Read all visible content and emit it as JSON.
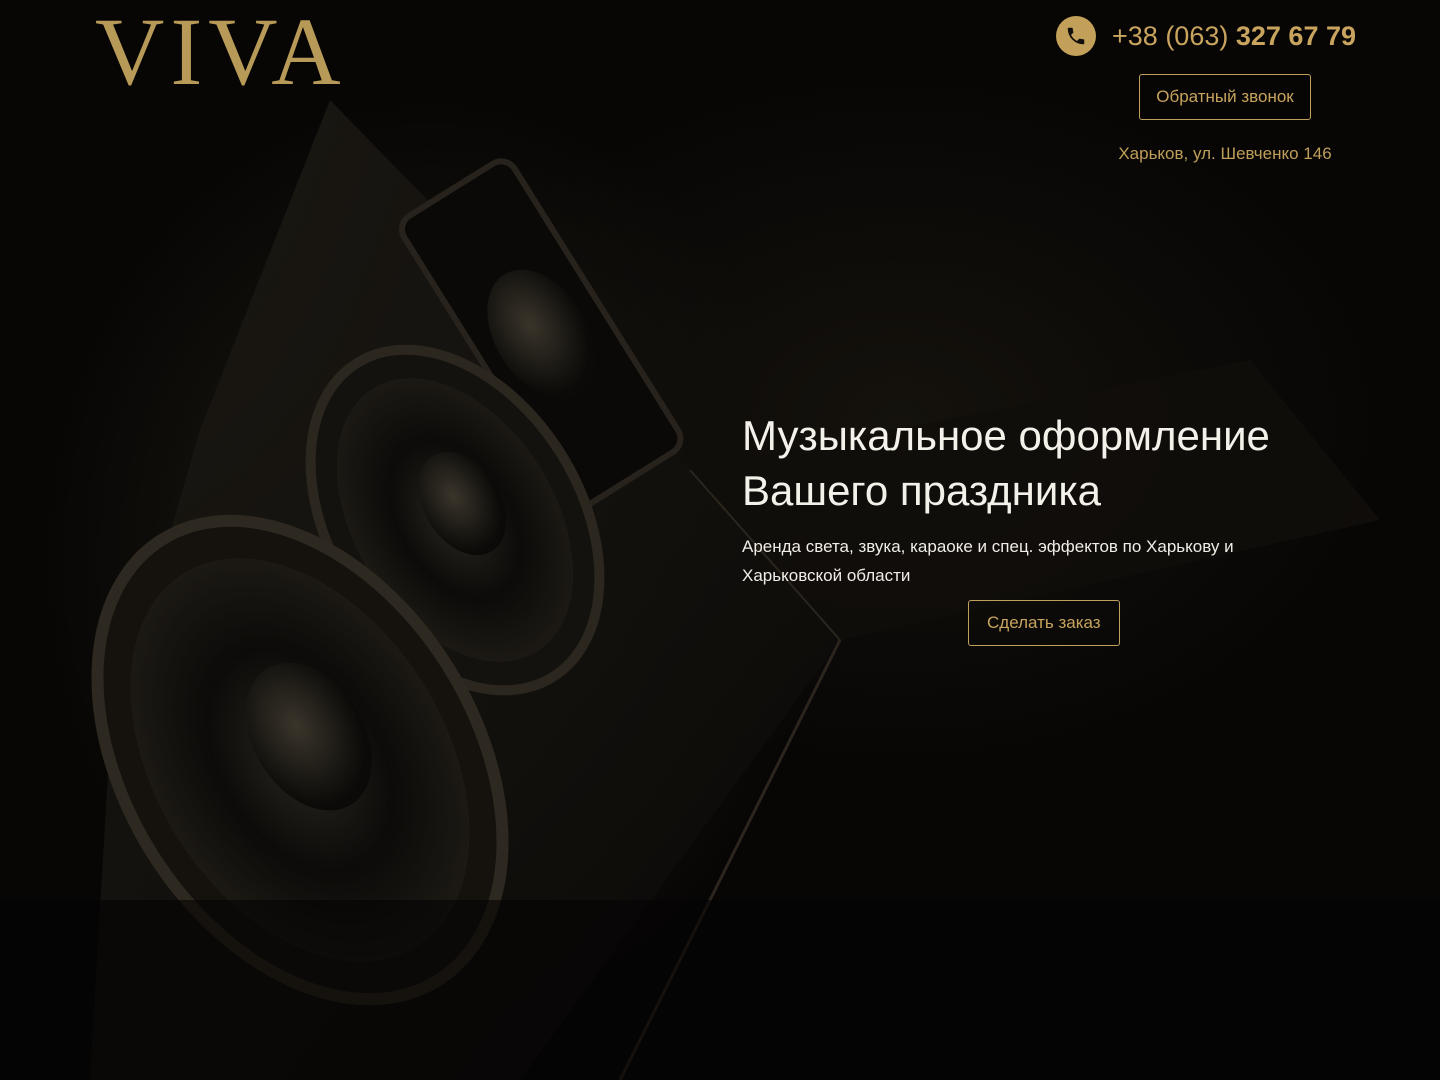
{
  "brand": {
    "logo_text": "VIVA"
  },
  "contact": {
    "phone_prefix": "+38 (063)",
    "phone_main": "327 67 79",
    "phone_icon": "phone-icon",
    "callback_label": "Обратный звонок",
    "address": "Харьков, ул. Шевченко 146"
  },
  "hero": {
    "title_line1": "Музыкальное оформление",
    "title_line2": "Вашего праздника",
    "subtitle": "Аренда света, звука, караоке и спец. эффектов по Харькову и Харьковской области",
    "order_label": "Сделать заказ"
  },
  "colors": {
    "accent": "#c2a05a",
    "background": "#070605",
    "text_light": "#f4f1ea"
  }
}
